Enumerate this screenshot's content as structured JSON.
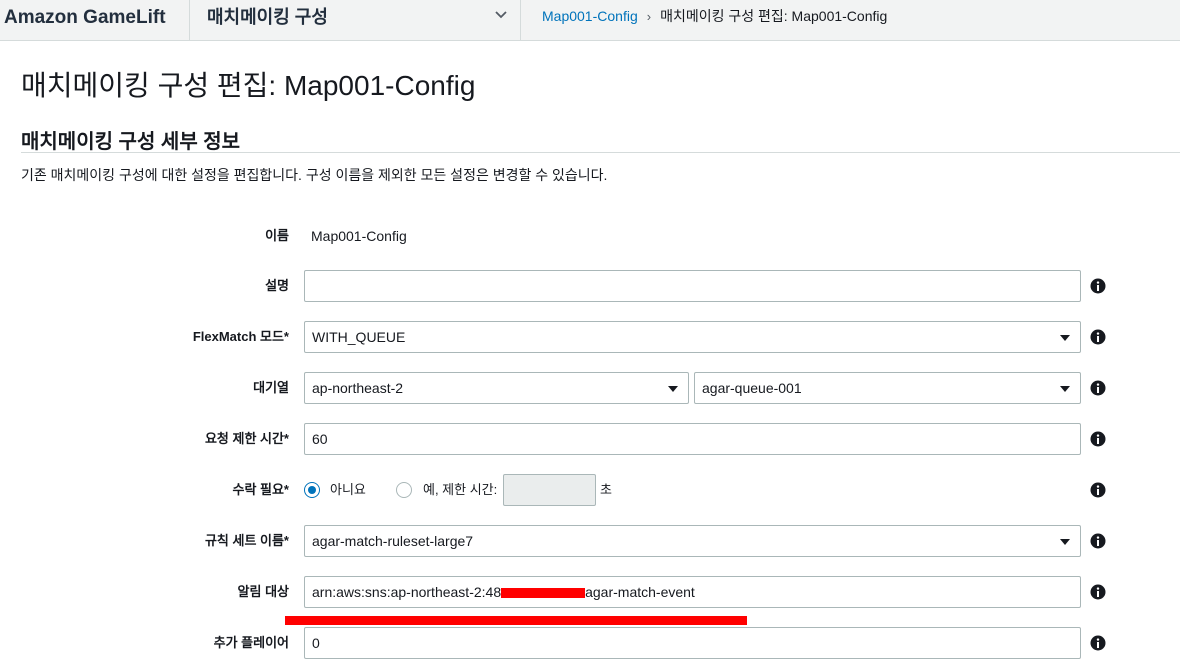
{
  "header": {
    "brand": "Amazon GameLift",
    "service_menu": "매치메이킹 구성",
    "breadcrumb": {
      "link": "Map001-Config",
      "separator": "›",
      "current": "매치메이킹 구성 편집: Map001-Config"
    }
  },
  "page": {
    "title": "매치메이킹 구성 편집: Map001-Config",
    "section_title": "매치메이킹 구성 세부 정보",
    "section_description": "기존 매치메이킹 구성에 대한 설정을 편집합니다. 구성 이름을 제외한 모든 설정은 변경할 수 있습니다."
  },
  "form": {
    "name": {
      "label": "이름",
      "value": "Map001-Config"
    },
    "description": {
      "label": "설명",
      "value": ""
    },
    "flexmatch_mode": {
      "label": "FlexMatch 모드*",
      "value": "WITH_QUEUE"
    },
    "queue": {
      "label": "대기열",
      "region": "ap-northeast-2",
      "queue_name": "agar-queue-001"
    },
    "request_timeout": {
      "label": "요청 제한 시간*",
      "value": "60"
    },
    "acceptance_required": {
      "label": "수락 필요*",
      "option_no": "아니요",
      "option_yes": "예, 제한 시간:",
      "timeout_value": "",
      "unit": "초",
      "selected": "no"
    },
    "rule_set": {
      "label": "규칙 세트 이름*",
      "value": "agar-match-ruleset-large7"
    },
    "notification_target": {
      "label": "알림 대상",
      "value_prefix": "arn:aws:sns:ap-northeast-2:48",
      "value_suffix": "agar-match-event"
    },
    "additional_players": {
      "label": "추가 플레이어",
      "value": "0"
    }
  },
  "icons": {
    "info": "info-circle-icon",
    "service_dropdown": "chevron-down-icon"
  },
  "colors": {
    "link": "#0073bb",
    "radio_selected": "#0073bb",
    "redaction": "#ff0000"
  }
}
